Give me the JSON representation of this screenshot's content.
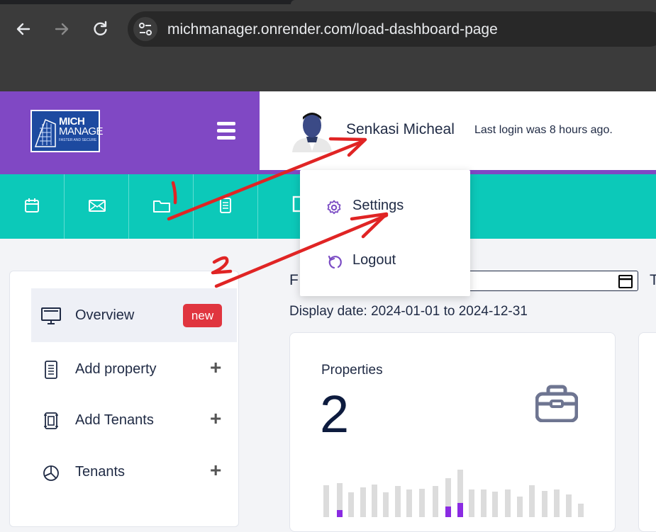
{
  "browser": {
    "url": "michmanager.onrender.com/load-dashboard-page",
    "back_icon": "arrow-left-icon",
    "forward_icon": "arrow-right-icon",
    "reload_icon": "reload-icon"
  },
  "brand": {
    "logo_line1": "MICH",
    "logo_line2": "MANAGE",
    "logo_tagline": "FASTER AND SECURE",
    "color": "#8048c4"
  },
  "header": {
    "username": "Senkasi Micheal",
    "last_login": "Last login was 8 hours ago."
  },
  "icon_strip": {
    "color": "#0cc9b9",
    "icons": [
      "calendar-icon",
      "mail-icon",
      "folder-icon",
      "document-icon",
      "square-icon"
    ]
  },
  "dropdown": {
    "items": [
      {
        "label": "Settings",
        "icon": "gear-icon"
      },
      {
        "label": "Logout",
        "icon": "logout-icon"
      }
    ]
  },
  "sidebar": {
    "items": [
      {
        "label": "Overview",
        "icon": "monitor-icon",
        "badge": "new"
      },
      {
        "label": "Add property",
        "icon": "document-icon",
        "action": "+"
      },
      {
        "label": "Add Tenants",
        "icon": "frame-icon",
        "action": "+"
      },
      {
        "label": "Tenants",
        "icon": "pie-icon",
        "action": "+"
      }
    ]
  },
  "filters": {
    "from_label": "F",
    "to_label": "T",
    "display_date": "Display date: 2024-01-01 to 2024-12-31"
  },
  "stats_card": {
    "title": "Properties",
    "value": "2",
    "icon": "briefcase-icon"
  },
  "annotations": {
    "marker_1": "1",
    "marker_2": "2",
    "color": "#e02424"
  }
}
